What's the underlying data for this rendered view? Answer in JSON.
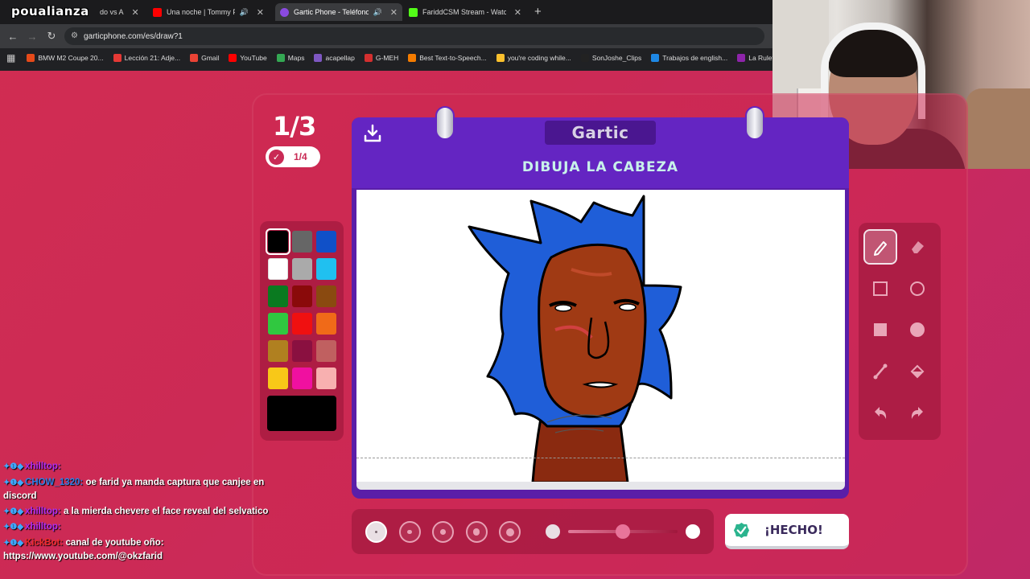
{
  "overlay": {
    "streamer_name": "poualianza"
  },
  "browser": {
    "tabs": [
      {
        "title": "do vs A",
        "active": false
      },
      {
        "title": "Una noche | Tommy Portug",
        "active": false,
        "sound": true
      },
      {
        "title": "Gartic Phone - Teléfono De",
        "active": true,
        "sound": true
      },
      {
        "title": "FariddCSM Stream - Watch Live",
        "active": false
      }
    ],
    "url": "garticphone.com/es/draw?1",
    "bookmarks": [
      {
        "label": "BMW M2 Coupe 20...",
        "color": "#e64a19"
      },
      {
        "label": "Lección 21: Adje...",
        "color": "#e53935"
      },
      {
        "label": "Gmail",
        "color": "#ea4335"
      },
      {
        "label": "YouTube",
        "color": "#ff0000"
      },
      {
        "label": "Maps",
        "color": "#34a853"
      },
      {
        "label": "acapellap",
        "color": "#7e57c2"
      },
      {
        "label": "G-MEH",
        "color": "#d32f2f"
      },
      {
        "label": "Best Text-to-Speech...",
        "color": "#f57c00"
      },
      {
        "label": "you're coding while...",
        "color": "#fbc02d"
      },
      {
        "label": "SonJoshe_Clips",
        "color": "#222222"
      },
      {
        "label": "Trabajos de english...",
        "color": "#1e88e5"
      },
      {
        "label": "La Ruleta",
        "color": "#8e24aa"
      }
    ]
  },
  "game": {
    "round": "1/3",
    "players_done": "1/4",
    "logo": "Gartic",
    "prompt": "DIBUJA LA CABEZA",
    "done_button": "¡HECHO!",
    "palette": [
      "#000000",
      "#666666",
      "#1050c8",
      "#ffffff",
      "#aaaaaa",
      "#20c0f0",
      "#0a7a20",
      "#8a0a0a",
      "#8a4a10",
      "#30c840",
      "#f01010",
      "#f06a18",
      "#b08020",
      "#8a1040",
      "#c06060",
      "#f8c818",
      "#f010a0",
      "#f8b0b0"
    ],
    "selected_color": "#000000",
    "brush_sizes": [
      1,
      2,
      3,
      4,
      5
    ],
    "selected_brush": 1,
    "opacity_value": 0.5
  },
  "chat": [
    {
      "user": "xhilltop:",
      "user_color": "purple",
      "message": ""
    },
    {
      "user": "CHOW_1320:",
      "user_color": "blue",
      "message": "oe farid ya manda captura que canjee en discord"
    },
    {
      "user": "xhilltop:",
      "user_color": "purple",
      "message": "a la mierda chevere el face reveal del selvatico"
    },
    {
      "user": "xhilltop:",
      "user_color": "purple",
      "message": ""
    },
    {
      "user": "KickBot:",
      "user_color": "red",
      "message": "canal de youtube oño: https://www.youtube.com/@okzfarid"
    }
  ]
}
